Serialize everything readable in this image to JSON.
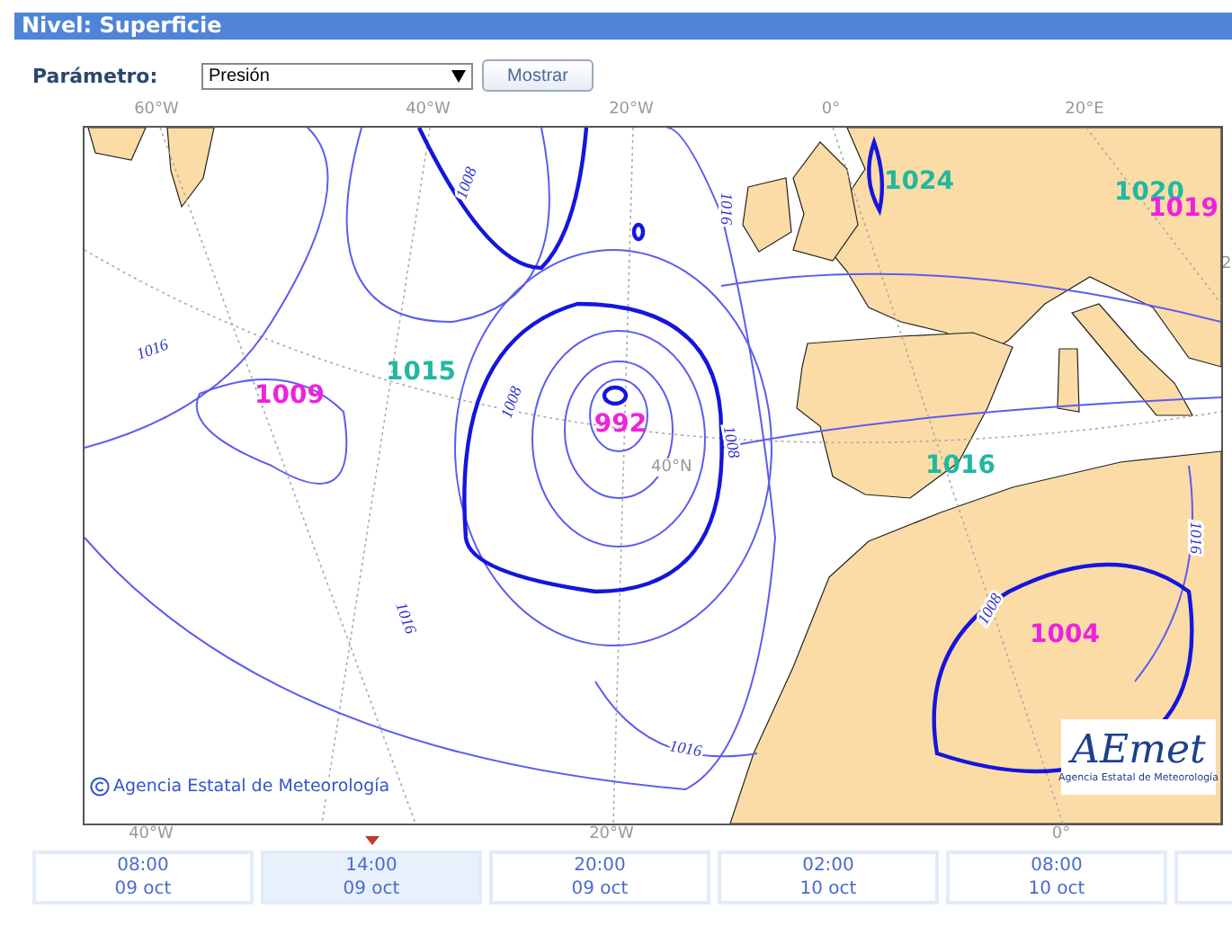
{
  "header": {
    "title": "Nivel: Superficie"
  },
  "parameter": {
    "label": "Parámetro:",
    "value": "Presión",
    "button": "Mostrar"
  },
  "map": {
    "top_ticks": [
      "60°W",
      "40°W",
      "20°W",
      "0°",
      "20°E"
    ],
    "right_tick": "2",
    "bottom_ticks": [
      "40°W",
      "20°W",
      "0°"
    ],
    "inner_label": "40°N",
    "centers": [
      {
        "value": "1024",
        "kind": "high"
      },
      {
        "value": "1020",
        "kind": "high"
      },
      {
        "value": "1019",
        "kind": "low"
      },
      {
        "value": "1015",
        "kind": "high"
      },
      {
        "value": "1009",
        "kind": "low"
      },
      {
        "value": "992",
        "kind": "low"
      },
      {
        "value": "1016",
        "kind": "high"
      },
      {
        "value": "1004",
        "kind": "low"
      }
    ],
    "contour_labels": [
      "1008",
      "1016",
      "1016",
      "1008",
      "1008",
      "1016",
      "1008",
      "1016",
      "1016"
    ],
    "copyright": "Agencia Estatal de Meteorología",
    "logo": {
      "wordmark": "AEmet",
      "subtitle": "Agencia Estatal de Meteorología"
    }
  },
  "timeline": [
    {
      "time": "08:00",
      "date": "09 oct",
      "selected": false
    },
    {
      "time": "14:00",
      "date": "09 oct",
      "selected": true
    },
    {
      "time": "20:00",
      "date": "09 oct",
      "selected": false
    },
    {
      "time": "02:00",
      "date": "10 oct",
      "selected": false
    },
    {
      "time": "08:00",
      "date": "10 oct",
      "selected": false
    }
  ]
}
